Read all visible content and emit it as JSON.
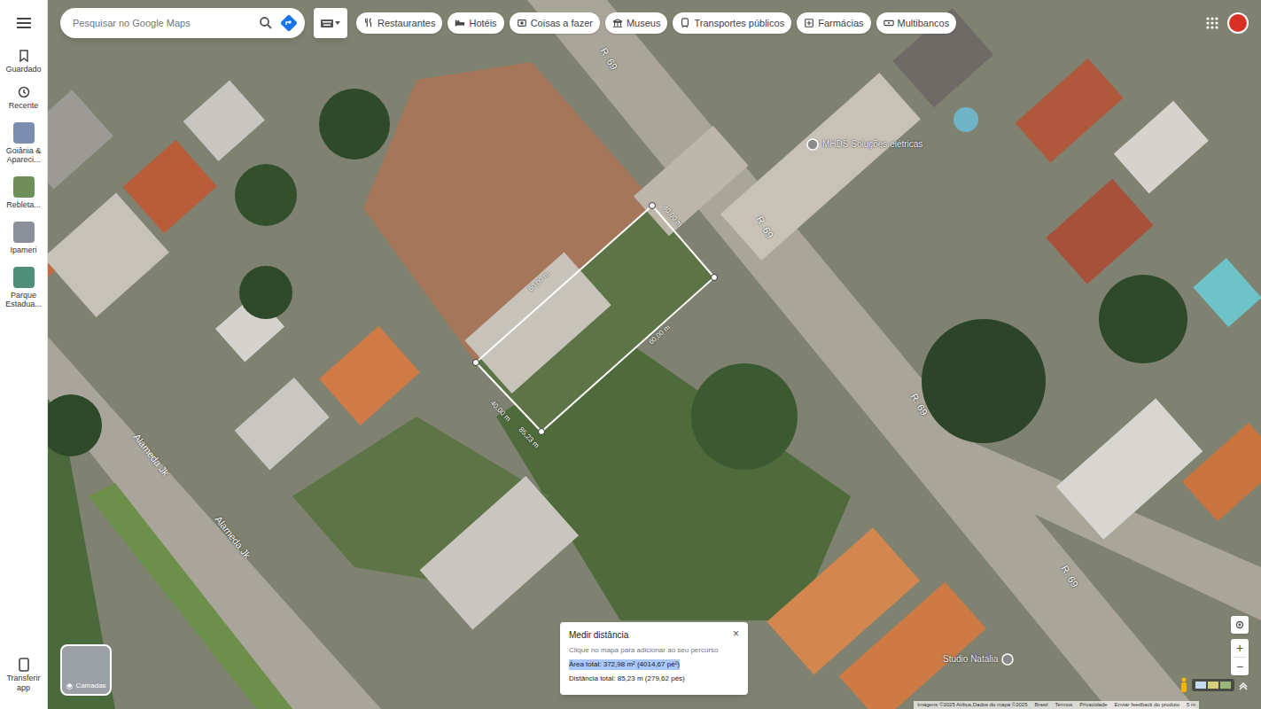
{
  "search": {
    "placeholder": "Pesquisar no Google Maps"
  },
  "sidebar": {
    "items": [
      {
        "label": "Guardado",
        "kind": "icon"
      },
      {
        "label": "Recente",
        "kind": "icon"
      },
      {
        "label": "Goiânia & Apareci...",
        "kind": "thumb",
        "color": "#7a8fb0"
      },
      {
        "label": "Rebleta...",
        "kind": "thumb",
        "color": "#6f8f5a"
      },
      {
        "label": "Ipameri",
        "kind": "thumb",
        "color": "#8a8f9a"
      },
      {
        "label": "Parque Estadua...",
        "kind": "thumb",
        "color": "#4f8f7a"
      }
    ],
    "download": "Transferir app"
  },
  "chips": [
    "Restaurantes",
    "Hotéis",
    "Coisas a fazer",
    "Museus",
    "Transportes públicos",
    "Farmácias",
    "Multibancos"
  ],
  "map": {
    "streets": [
      "R. 69",
      "R. 69",
      "R. 69",
      "R. 69",
      "Alameda Jk",
      "Alameda Jk"
    ],
    "places": [
      "MHDS Soluções elétricas",
      "Studio Natalia"
    ],
    "measure_labels": [
      "60,00 m",
      "40,00 m",
      "60,00 m",
      "40,00 m",
      "85,23 m"
    ]
  },
  "layers": {
    "label": "Camadas"
  },
  "measure": {
    "title": "Medir distância",
    "close": "×",
    "hint": "Clique no mapa para adicionar ao seu percurso",
    "area": "Área total: 372,98 m² (4014,67 pé²)",
    "distance": "Distância total: 85,23 m (279,62 pés)"
  },
  "zoom": {
    "in": "+",
    "out": "−"
  },
  "attribution": [
    "Imagens ©2025 Airbus,Dados do mapa ©2025",
    "Brasil",
    "Termos",
    "Privacidade",
    "Enviar feedback do produto",
    "5 m"
  ]
}
